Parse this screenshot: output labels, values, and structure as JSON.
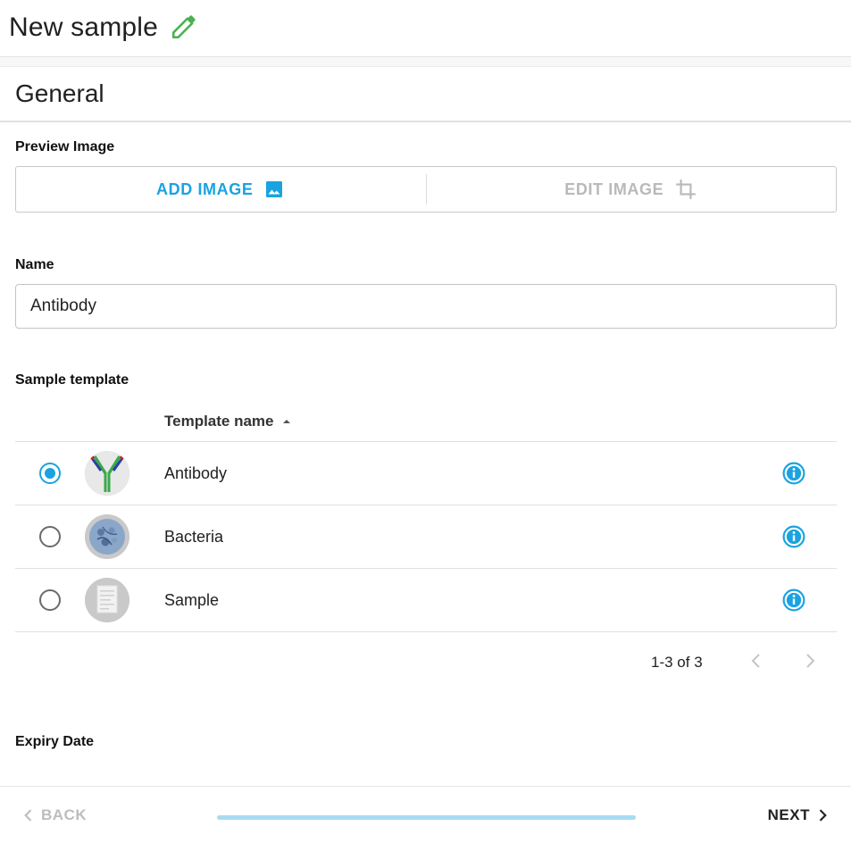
{
  "header": {
    "title": "New sample"
  },
  "general": {
    "title": "General"
  },
  "preview_image": {
    "label": "Preview Image",
    "add_label": "ADD IMAGE",
    "edit_label": "EDIT IMAGE"
  },
  "name": {
    "label": "Name",
    "value": "Antibody"
  },
  "sample_template": {
    "label": "Sample template",
    "column_header": "Template name",
    "rows": [
      {
        "name": "Antibody",
        "selected": true
      },
      {
        "name": "Bacteria",
        "selected": false
      },
      {
        "name": "Sample",
        "selected": false
      }
    ],
    "pagination": "1-3 of 3"
  },
  "expiry": {
    "label": "Expiry Date"
  },
  "footer": {
    "back_label": "BACK",
    "next_label": "NEXT",
    "progress_fraction": 1.0
  },
  "colors": {
    "accent": "#1aa3e0",
    "edit_icon": "#4caf50",
    "disabled": "#b9b9b9"
  },
  "icons": [
    "edit-pencil-icon",
    "image-icon",
    "crop-icon",
    "sort-ascending-icon",
    "info-icon",
    "chevron-left-icon",
    "chevron-right-icon"
  ]
}
